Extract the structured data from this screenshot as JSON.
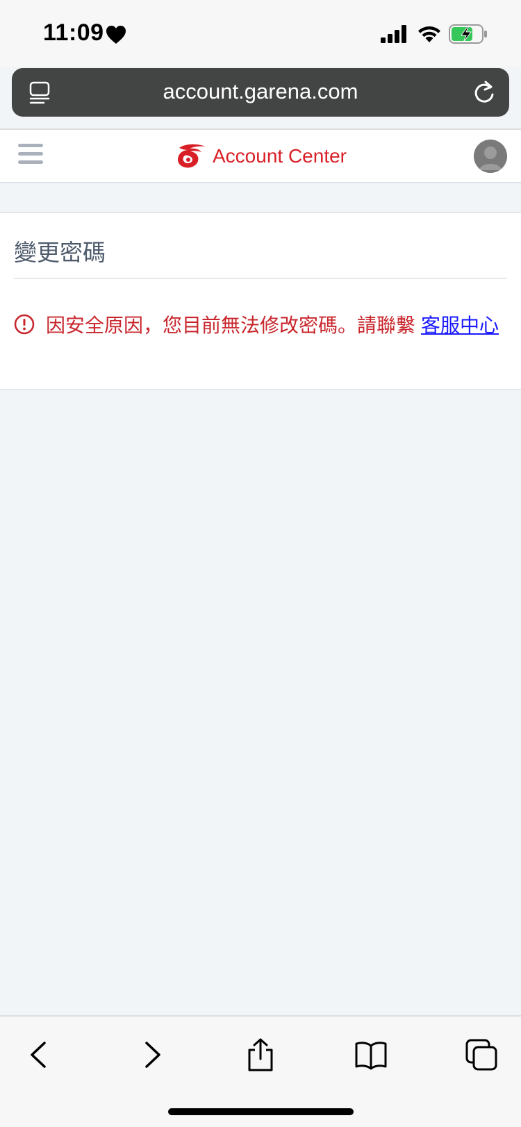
{
  "status_bar": {
    "time": "11:09"
  },
  "browser": {
    "url": "account.garena.com"
  },
  "header": {
    "brand": "Account Center",
    "brand_color": "#d81f26"
  },
  "card": {
    "title": "變更密碼",
    "error_message": "因安全原因，您目前無法修改密碼。請聯繫",
    "support_link": "客服中心",
    "error_color": "#c8262c"
  },
  "toolbar": {
    "buttons": [
      "back-icon",
      "forward-icon",
      "share-icon",
      "bookmarks-icon",
      "tabs-icon"
    ]
  }
}
